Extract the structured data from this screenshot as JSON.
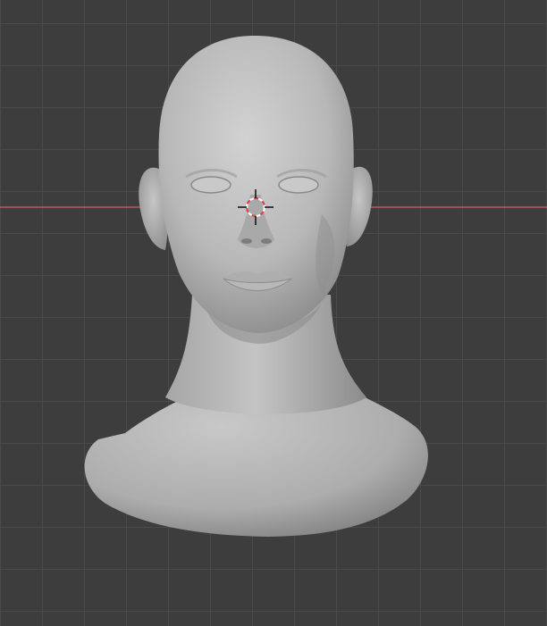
{
  "viewport": {
    "background_color": "#3d3d3d",
    "grid_color": "#4a4a4a",
    "x_axis_color": "#b35a64"
  },
  "model": {
    "kind": "sculpt-head-bust",
    "surface_color": "#b4b4b4",
    "shadow_color": "#6e6e6e",
    "highlight_color": "#d2d2d2"
  },
  "cursor_3d": {
    "icon": "3d-cursor-icon",
    "ring_color_a": "#ffffff",
    "ring_color_b": "#e0404a",
    "crosshair_color": "#000000"
  }
}
